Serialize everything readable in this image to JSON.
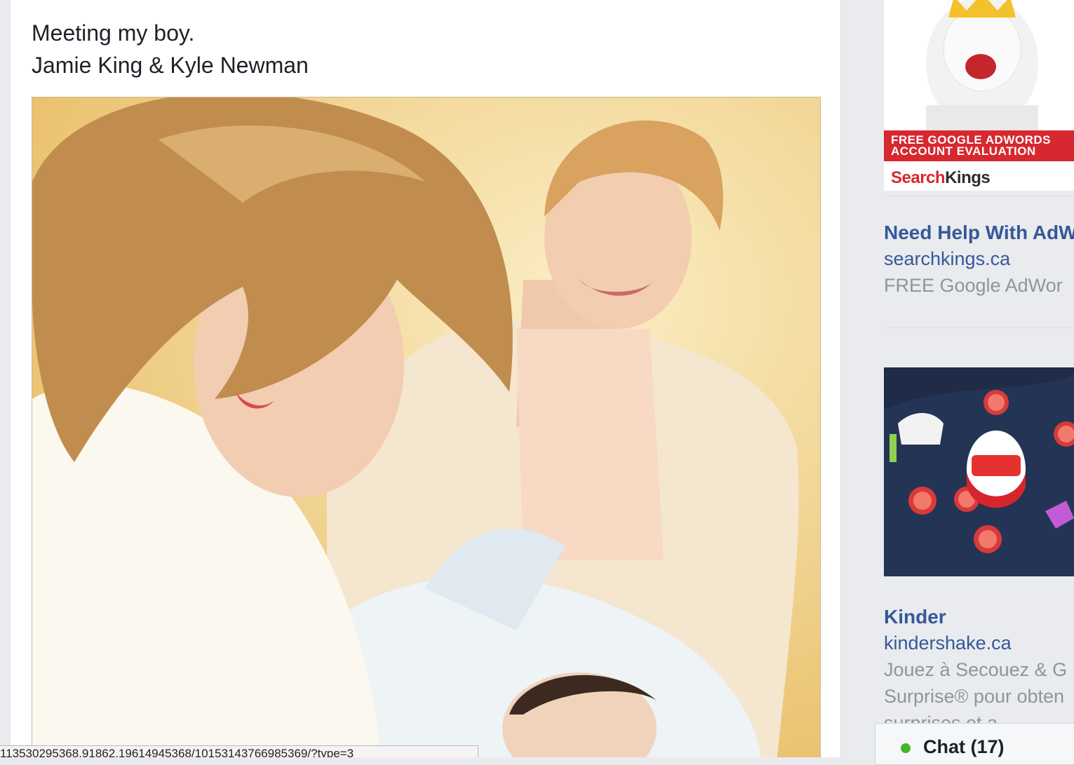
{
  "post": {
    "caption_line1": "Meeting my boy.",
    "caption_line2": "Jamie King & Kyle Newman"
  },
  "ads": [
    {
      "banner_line1": "FREE GOOGLE ADWORDS",
      "banner_line2": "ACCOUNT EVALUATION",
      "brand_part1": "Search",
      "brand_part2": "Kings",
      "title": "Need Help With AdW",
      "domain": "searchkings.ca",
      "description_line1": "FREE Google AdWor"
    },
    {
      "title": "Kinder",
      "domain": "kindershake.ca",
      "description_line1": "Jouez à Secouez & G",
      "description_line2": "Surprise® pour obten",
      "description_line3": "surprises et a..."
    }
  ],
  "status_bar": {
    "url": "113530295368.91862.19614945368/10153143766985369/?type=3"
  },
  "chat": {
    "label": "Chat (17)",
    "status_color": "#42b72a"
  },
  "colors": {
    "link": "#365899",
    "muted": "#90949c",
    "page_bg": "#e9ebee",
    "ad_red": "#d7282f"
  }
}
